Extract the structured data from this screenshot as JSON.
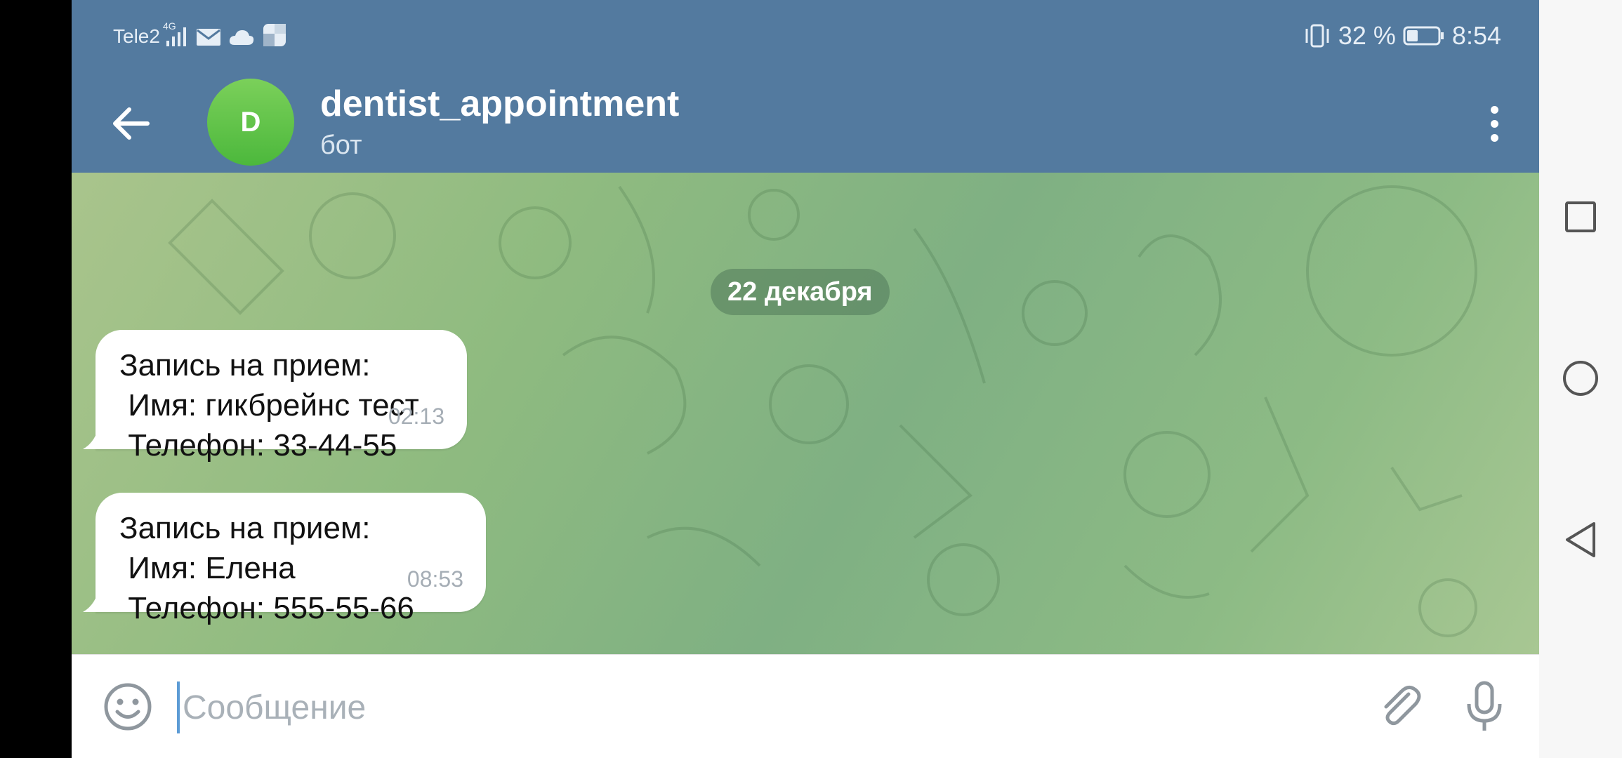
{
  "status_bar": {
    "carrier": "Tele2",
    "network": "4G",
    "battery": "32 %",
    "time": "8:54",
    "icons": [
      "signal-icon",
      "mail-icon",
      "cloud-icon",
      "app-notification-icon",
      "vibrate-icon",
      "battery-icon"
    ]
  },
  "header": {
    "avatar_letter": "D",
    "title": "dentist_appointment",
    "subtitle": "бот",
    "colors": {
      "header": "#537a9f",
      "avatar": "#5cc44a"
    }
  },
  "chat": {
    "date_separator": "22 декабря",
    "messages": [
      {
        "lines": [
          "Запись на прием:",
          " Имя: гикбрейнс тест",
          " Телефон: 33-44-55"
        ],
        "time": "02:13"
      },
      {
        "lines": [
          "Запись на прием:",
          " Имя: Елена",
          " Телефон: 555-55-66"
        ],
        "time": "08:53"
      }
    ]
  },
  "input": {
    "placeholder": "Сообщение",
    "value": ""
  },
  "nav": {
    "icons": [
      "recent-apps-icon",
      "home-icon",
      "back-triangle-icon"
    ]
  }
}
